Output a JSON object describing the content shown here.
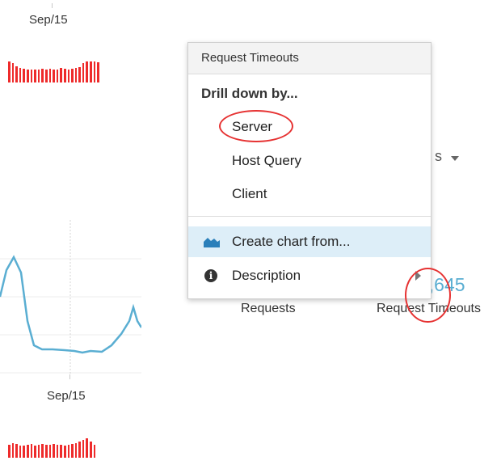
{
  "timeline": {
    "top_date": "Sep/15",
    "bottom_date": "Sep/15"
  },
  "menu": {
    "header": "Request Timeouts",
    "section_title": "Drill down by...",
    "drill_items": [
      {
        "label": "Server"
      },
      {
        "label": "Host Query"
      },
      {
        "label": "Client"
      }
    ],
    "create_chart_label": "Create chart from...",
    "description_label": "Description",
    "info_icon_glyph": "i"
  },
  "background": {
    "dropdown_tail": "s",
    "metric_value": "4,645",
    "metric_labels": [
      "Requests",
      "Request Timeouts"
    ]
  },
  "icons": {
    "chart": "area-chart-icon",
    "info": "info-icon",
    "submenu": "chevron-right-icon",
    "dropdown": "caret-down-icon"
  },
  "colors": {
    "bar_red": "#ee2b2b",
    "line_blue": "#5aaed2",
    "highlight": "#ddeef8",
    "annotation_red": "#e63232"
  }
}
